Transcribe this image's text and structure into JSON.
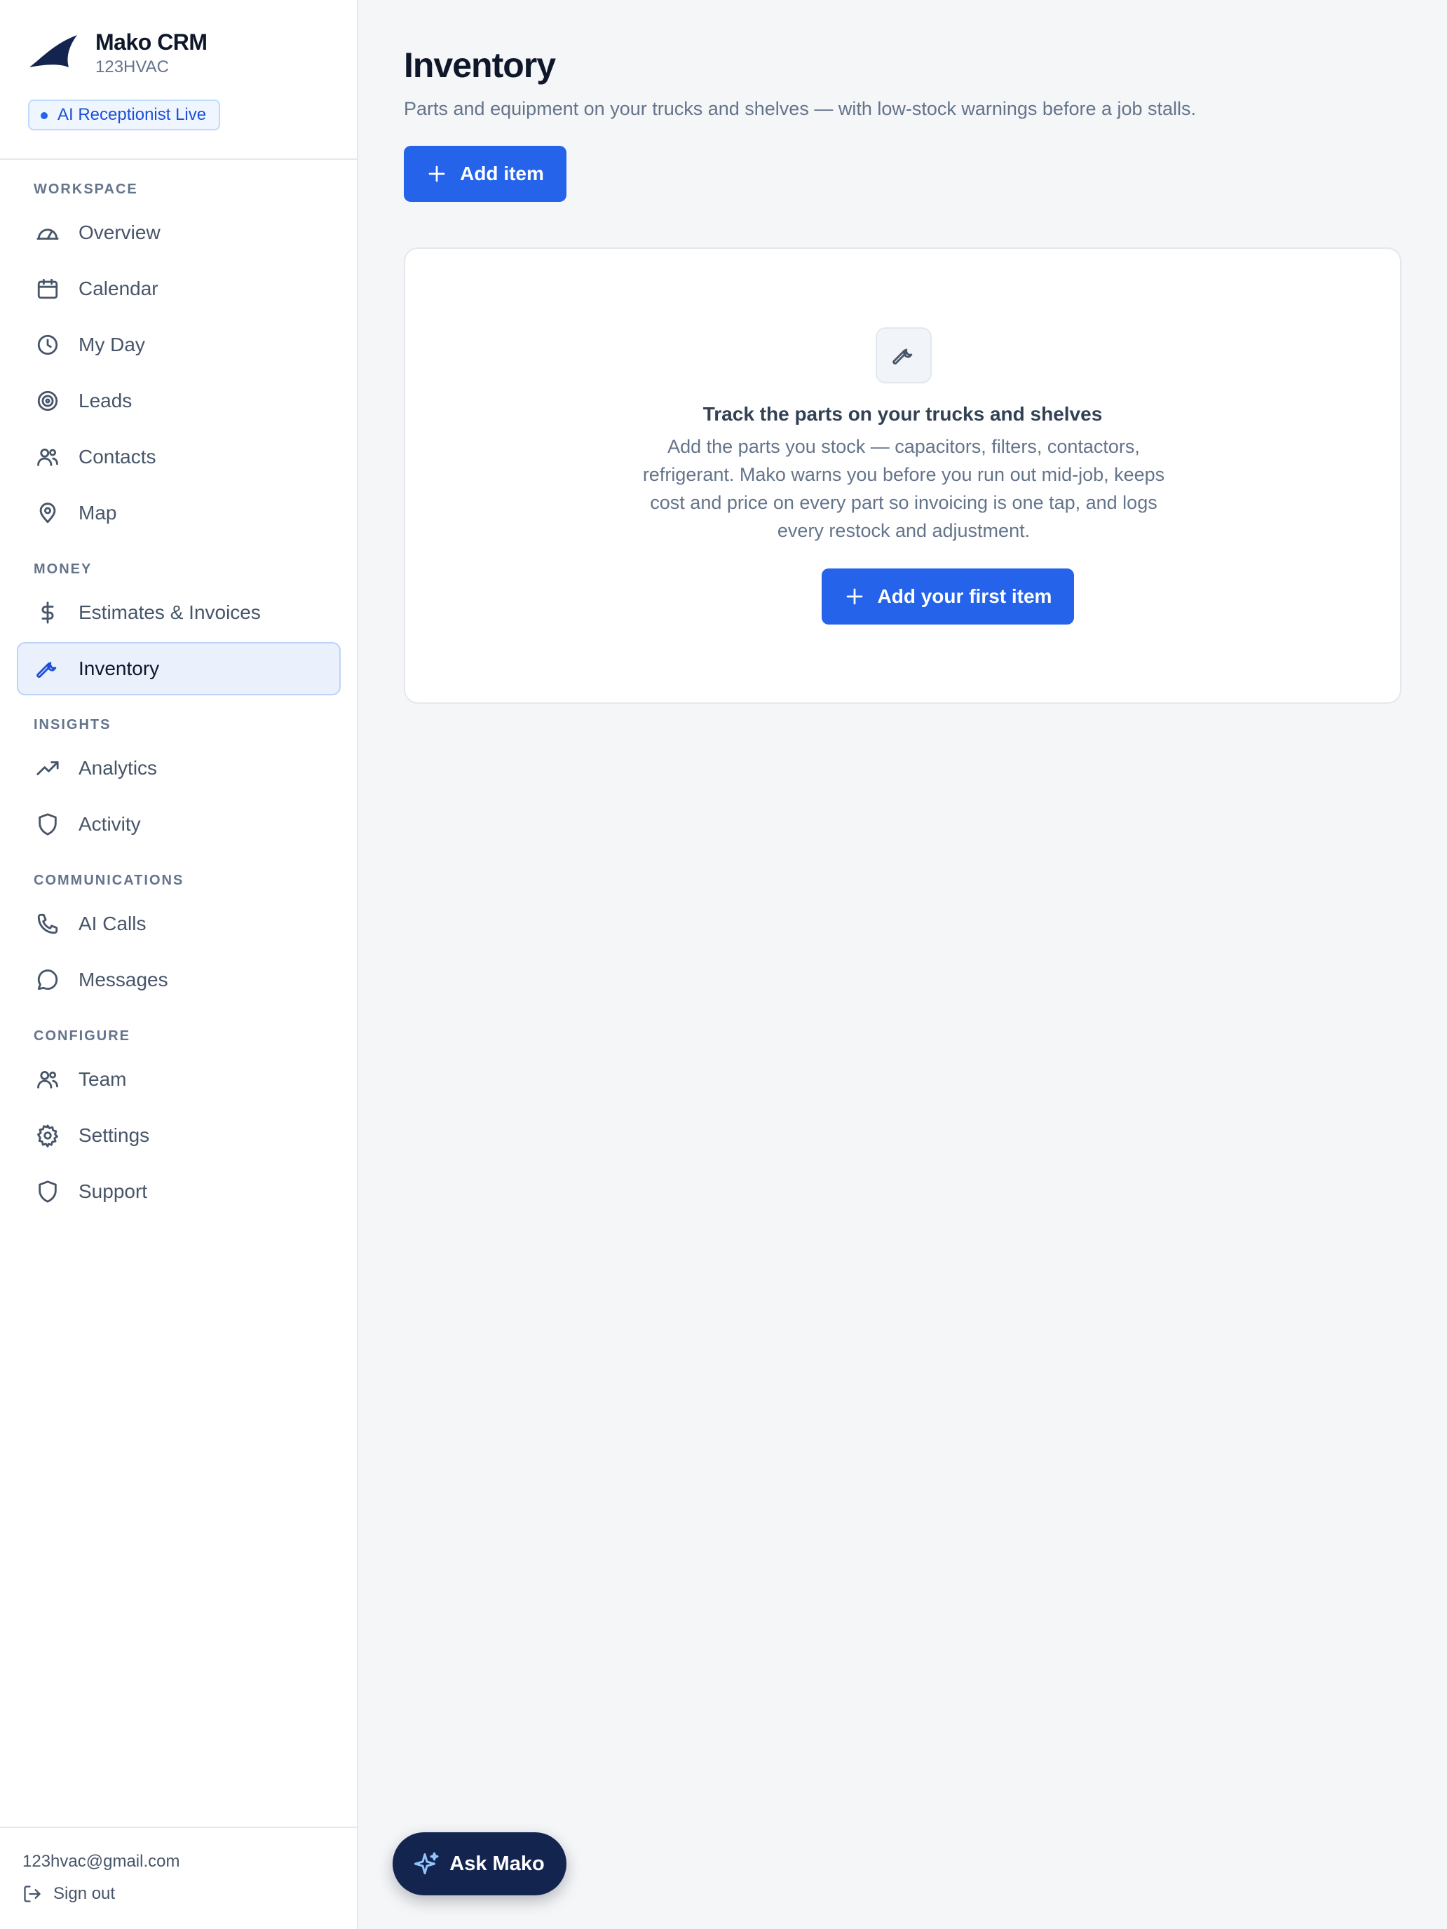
{
  "colors": {
    "accent": "#2563eb",
    "sidebar_bg": "#ffffff",
    "main_bg": "#f5f6f8",
    "active_nav_bg": "#eaf1fd",
    "ask_button_bg": "#13244f"
  },
  "brand": {
    "name": "Mako CRM",
    "account": "123HVAC",
    "logo_icon": "shark-fin-icon",
    "status_badge": "AI Receptionist Live"
  },
  "sidebar": {
    "sections": [
      {
        "title": "WORKSPACE",
        "items": [
          {
            "label": "Overview",
            "icon": "gauge-icon"
          },
          {
            "label": "Calendar",
            "icon": "calendar-icon"
          },
          {
            "label": "My Day",
            "icon": "clock-icon"
          },
          {
            "label": "Leads",
            "icon": "target-icon"
          },
          {
            "label": "Contacts",
            "icon": "users-icon"
          },
          {
            "label": "Map",
            "icon": "map-pin-icon"
          }
        ]
      },
      {
        "title": "MONEY",
        "items": [
          {
            "label": "Estimates & Invoices",
            "icon": "dollar-icon"
          },
          {
            "label": "Inventory",
            "icon": "wrench-icon",
            "active": true
          }
        ]
      },
      {
        "title": "INSIGHTS",
        "items": [
          {
            "label": "Analytics",
            "icon": "trending-up-icon"
          },
          {
            "label": "Activity",
            "icon": "shield-icon"
          }
        ]
      },
      {
        "title": "COMMUNICATIONS",
        "items": [
          {
            "label": "AI Calls",
            "icon": "phone-icon"
          },
          {
            "label": "Messages",
            "icon": "message-icon"
          }
        ]
      },
      {
        "title": "CONFIGURE",
        "items": [
          {
            "label": "Team",
            "icon": "users-icon"
          },
          {
            "label": "Settings",
            "icon": "gear-icon"
          },
          {
            "label": "Support",
            "icon": "shield-icon"
          }
        ]
      }
    ],
    "footer": {
      "email": "123hvac@gmail.com",
      "signout_label": "Sign out"
    }
  },
  "main": {
    "title": "Inventory",
    "subtitle": "Parts and equipment on your trucks and shelves — with low-stock warnings before a job stalls.",
    "add_button_label": "Add item",
    "empty_state": {
      "icon": "wrench-icon",
      "title": "Track the parts on your trucks and shelves",
      "body": "Add the parts you stock — capacitors, filters, contactors, refrigerant. Mako warns you before you run out mid-job, keeps cost and price on every part so invoicing is one tap, and logs every restock and adjustment.",
      "cta_label": "Add your first item"
    },
    "ask_button_label": "Ask Mako"
  }
}
